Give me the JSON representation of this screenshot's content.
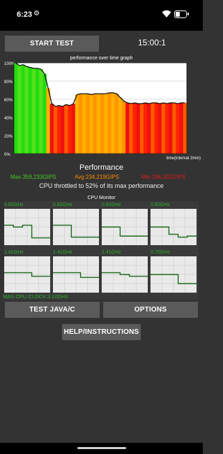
{
  "status": {
    "time": "6:23",
    "settings_glyph": "⚙"
  },
  "controls": {
    "start_label": "START TEST",
    "timer": "15:00:1",
    "test_label": "TEST JAVA/C",
    "options_label": "OPTIONS",
    "help_label": "HELP/INSTRUCTIONS"
  },
  "graph": {
    "title": "performance over time graph",
    "y_ticks": [
      "100%",
      "80%",
      "60%",
      "40%",
      "20%",
      "0%"
    ],
    "x_label": "time(interval 2min)"
  },
  "performance": {
    "title": "Performance",
    "max": "Max 359,233GIPS",
    "avg": "Avg 234,219GIPS",
    "min": "Min 186,302GIPS",
    "throttle": "CPU throttled to 52% of its max performance"
  },
  "cpu_monitor": {
    "title": "CPU Monitor",
    "max_clock": "MAX CPU CLOCK:3.10GHz",
    "cores": [
      {
        "freq": "0.82GHz",
        "levels": [
          0.55,
          0.5,
          0.55,
          0.2,
          0.2
        ]
      },
      {
        "freq": "0.82GHz",
        "levels": [
          0.55,
          0.55,
          0.22,
          0.22,
          0.22
        ]
      },
      {
        "freq": "0.82GHz",
        "levels": [
          0.5,
          0.5,
          0.25,
          0.25,
          0.25
        ]
      },
      {
        "freq": "0.82GHz",
        "levels": [
          0.5,
          0.5,
          0.3,
          0.22,
          0.25
        ]
      },
      {
        "freq": "1.41GHz",
        "levels": [
          0.55,
          0.55,
          0.55,
          0.45,
          0.45
        ]
      },
      {
        "freq": "1.41GHz",
        "levels": [
          0.55,
          0.55,
          0.55,
          0.42,
          0.42
        ]
      },
      {
        "freq": "1.41GHz",
        "levels": [
          0.55,
          0.55,
          0.5,
          0.45,
          0.45
        ]
      },
      {
        "freq": "0.70GHz",
        "levels": [
          0.5,
          0.5,
          0.5,
          0.25,
          0.25
        ]
      }
    ]
  },
  "chart_data": {
    "type": "area",
    "title": "performance over time graph",
    "xlabel": "time(interval 2min)",
    "ylabel": "",
    "ylim": [
      0,
      100
    ],
    "grid": true,
    "y": [
      100,
      97,
      98,
      96,
      95,
      94,
      94,
      93,
      88,
      72,
      55,
      52,
      53,
      52,
      54,
      53,
      55,
      65,
      66,
      66,
      66,
      65,
      66,
      66,
      66,
      66,
      67,
      67,
      66,
      62,
      58,
      56,
      55,
      56,
      55,
      55,
      56,
      55,
      56,
      56,
      55,
      56,
      55,
      56,
      56,
      55,
      56,
      56
    ],
    "colors": [
      "#22dd11",
      "#ff7a00",
      "#ee1111",
      "#ffaa00",
      "#ff4400"
    ]
  }
}
